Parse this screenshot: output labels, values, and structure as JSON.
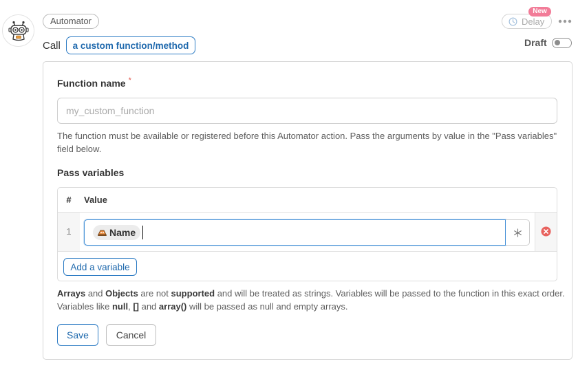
{
  "header": {
    "integration_tag": "Automator",
    "action_prefix": "Call",
    "action_token": "a custom function/method",
    "delay_label": "Delay",
    "new_badge": "New",
    "status_label": "Draft",
    "status_on": false
  },
  "form": {
    "function_name": {
      "label": "Function name",
      "required_mark": "*",
      "placeholder": "my_custom_function",
      "help": "The function must be available or registered before this Automator action. Pass the arguments by value in the \"Pass variables\" field below."
    },
    "pass_variables": {
      "label": "Pass variables",
      "columns": [
        "#",
        "Value"
      ],
      "rows": [
        {
          "index": "1",
          "token": "Name"
        }
      ],
      "add_label": "Add a variable",
      "note": [
        "Arrays",
        " and ",
        "Objects",
        " are not ",
        "supported",
        " and will be treated as strings. Variables will be passed to the function in this exact order. Variables like ",
        "null",
        ", ",
        "[]",
        " and ",
        "array()",
        " will be passed as null and empty arrays."
      ]
    }
  },
  "actions": {
    "save": "Save",
    "cancel": "Cancel"
  },
  "icons": {
    "avatar": "robot-icon",
    "delay": "clock-icon",
    "more": "more-horizontal-icon",
    "token": "token-icon",
    "insert_token": "asterisk-icon",
    "remove_row": "remove-circle-icon"
  },
  "colors": {
    "accent": "#2c7bc4",
    "accent_text": "#1f69ad",
    "required": "#e2574c",
    "danger": "#e8625e",
    "badge": "#f27c98"
  }
}
